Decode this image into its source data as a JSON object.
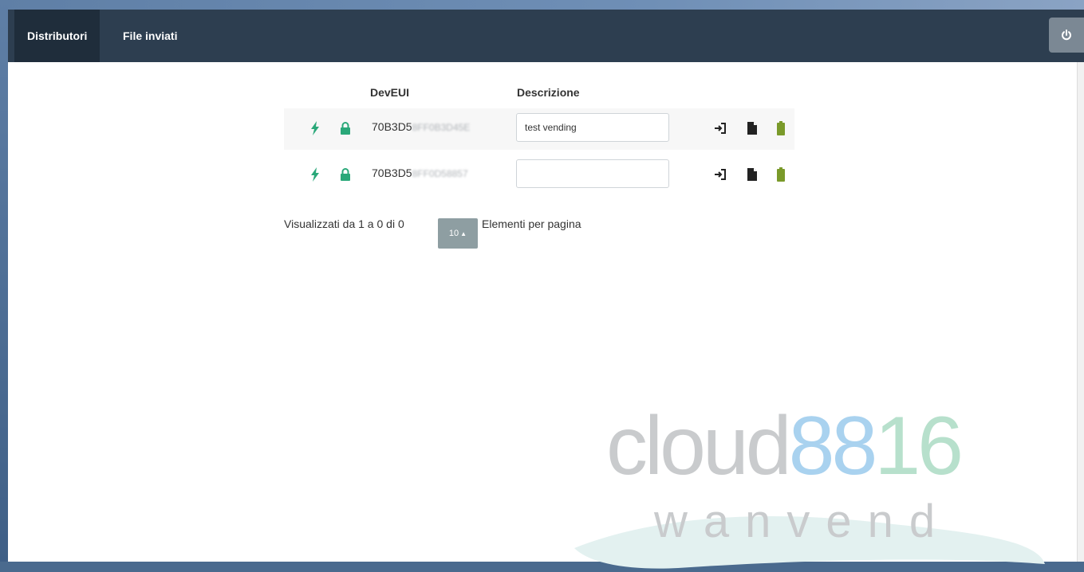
{
  "nav": {
    "items": [
      {
        "label": "Distributori",
        "active": true
      },
      {
        "label": "File inviati",
        "active": false
      }
    ],
    "power_icon": "power-icon"
  },
  "table": {
    "headers": {
      "deveui": "DevEUI",
      "descrizione": "Descrizione"
    },
    "rows": [
      {
        "deveui_prefix": "70B3D5",
        "deveui_masked": "8FF0B3D45E",
        "description": "test vending"
      },
      {
        "deveui_prefix": "70B3D5",
        "deveui_masked": "8FF0D58857",
        "description": ""
      }
    ],
    "row_icons": [
      "bolt-icon",
      "lock-icon",
      "sign-in-icon",
      "file-icon",
      "battery-icon"
    ]
  },
  "pagination": {
    "summary": "Visualizzati da 1 a 0 di 0",
    "page_size": "10",
    "page_size_suffix": "Elementi per pagina"
  },
  "logo": {
    "word": "cloud",
    "digits": "8816",
    "sub": "wanvend"
  },
  "colors": {
    "navbar": "#2d3e50",
    "accent_green": "#2aa879",
    "battery_green": "#7a9a2a"
  }
}
